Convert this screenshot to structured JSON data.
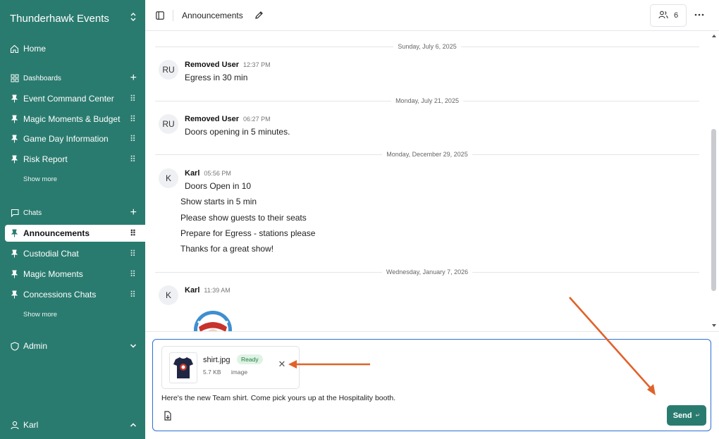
{
  "sidebar": {
    "org_name": "Thunderhawk Events",
    "home_label": "Home",
    "dashboards_label": "Dashboards",
    "dashboards": [
      {
        "label": "Event Command Center"
      },
      {
        "label": "Magic Moments & Budget"
      },
      {
        "label": "Game Day Information"
      },
      {
        "label": "Risk Report"
      }
    ],
    "dashboards_show_more": "Show more",
    "chats_label": "Chats",
    "chats": [
      {
        "label": "Announcements",
        "active": true
      },
      {
        "label": "Custodial Chat"
      },
      {
        "label": "Magic Moments"
      },
      {
        "label": "Concessions Chats"
      }
    ],
    "chats_show_more": "Show more",
    "admin_label": "Admin",
    "user_label": "Karl"
  },
  "header": {
    "channel_title": "Announcements",
    "member_count": "6"
  },
  "feed": {
    "dates": [
      "Sunday, July 6, 2025",
      "Monday, July 21, 2025",
      "Monday, December 29, 2025",
      "Wednesday, January 7, 2026"
    ],
    "messages": [
      {
        "initials": "RU",
        "author": "Removed User",
        "time": "12:37 PM",
        "lines": [
          "Egress in 30 min"
        ]
      },
      {
        "initials": "RU",
        "author": "Removed User",
        "time": "06:27 PM",
        "lines": [
          "Doors opening in 5 minutes."
        ]
      },
      {
        "initials": "K",
        "author": "Karl",
        "time": "05:56 PM",
        "lines": [
          "Doors Open in 10",
          "Show starts in 5 min",
          "Please show guests to their seats",
          "Prepare for Egress - stations please",
          "Thanks for a great show!"
        ]
      },
      {
        "initials": "K",
        "author": "Karl",
        "time": "11:39 AM",
        "lines": []
      }
    ]
  },
  "composer": {
    "attachment": {
      "file_name": "shirt.jpg",
      "status": "Ready",
      "size": "5.7 KB",
      "type": "image"
    },
    "message_text": "Here's the new Team shirt. Come pick yours up at the Hospitality booth.",
    "send_label": "Send",
    "send_shortcut": "↵"
  },
  "colors": {
    "sidebar_bg": "#2a7b6f",
    "accent": "#2a7b6f",
    "focus_border": "#2c6fd6",
    "annotation_arrow": "#e0622a"
  }
}
